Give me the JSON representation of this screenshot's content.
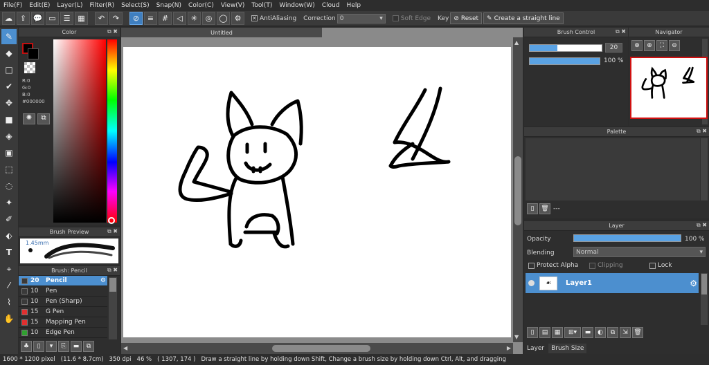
{
  "menu": [
    "File(F)",
    "Edit(E)",
    "Layer(L)",
    "Filter(R)",
    "Select(S)",
    "Snap(N)",
    "Color(C)",
    "View(V)",
    "Tool(T)",
    "Window(W)",
    "Cloud",
    "Help"
  ],
  "toolbar": {
    "antialiasing_label": "AntiAliasing",
    "correction_label": "Correction",
    "correction_value": "0",
    "soft_edge_label": "Soft Edge",
    "key_label": "Key",
    "reset_label": "Reset",
    "straight_line_label": "Create a straight line"
  },
  "tools": [
    "brush-tool",
    "eraser-tool",
    "select-rect-tool",
    "select-brush-tool",
    "move-tool",
    "fill-rect-tool",
    "bucket-tool",
    "gradient-tool",
    "select-rect-dotted-tool",
    "lasso-tool",
    "magic-wand-tool",
    "select-pen-tool",
    "select-eraser-tool",
    "text-tool",
    "operation-tool",
    "divide-tool",
    "eyedropper-tool",
    "hand-tool"
  ],
  "color_panel": {
    "title": "Color",
    "r": "R:0",
    "g": "G:0",
    "b": "B:0",
    "hex": "#000000",
    "foreground": "#000000",
    "accent": "#c01010"
  },
  "brush_preview": {
    "title": "Brush Preview",
    "size": "1.45mm"
  },
  "brush_panel": {
    "title": "Brush: Pencil",
    "items": [
      {
        "size": "20",
        "name": "Pencil",
        "color": "#3a3a3a",
        "selected": true
      },
      {
        "size": "10",
        "name": "Pen",
        "color": "#3a3a3a",
        "selected": false
      },
      {
        "size": "10",
        "name": "Pen (Sharp)",
        "color": "#3a3a3a",
        "selected": false
      },
      {
        "size": "15",
        "name": "G Pen",
        "color": "#e03030",
        "selected": false
      },
      {
        "size": "15",
        "name": "Mapping Pen",
        "color": "#e03030",
        "selected": false
      },
      {
        "size": "10",
        "name": "Edge Pen",
        "color": "#30a030",
        "selected": false
      }
    ]
  },
  "canvas": {
    "tab_title": "Untitled"
  },
  "brush_control": {
    "title": "Brush Control",
    "size_value": "20",
    "size_fill": 0.38,
    "opacity_value": "100 %",
    "opacity_fill": 1.0
  },
  "navigator": {
    "title": "Navigator"
  },
  "palette": {
    "title": "Palette",
    "footer_text": "---"
  },
  "layer_panel": {
    "title": "Layer",
    "opacity_label": "Opacity",
    "opacity_value": "100 %",
    "opacity_fill": 1.0,
    "blending_label": "Blending",
    "blending_value": "Normal",
    "protect_alpha_label": "Protect Alpha",
    "clipping_label": "Clipping",
    "lock_label": "Lock",
    "layer_name": "Layer1",
    "tab_layer": "Layer",
    "tab_brush_size": "Brush Size"
  },
  "status": {
    "size": "1600 * 1200 pixel",
    "physical": "(11.6 * 8.7cm)",
    "dpi": "350 dpi",
    "zoom": "46 %",
    "coords": "( 1307, 174 )",
    "hint": "Draw a straight line by holding down Shift, Change a brush size by holding down Ctrl, Alt, and dragging"
  }
}
